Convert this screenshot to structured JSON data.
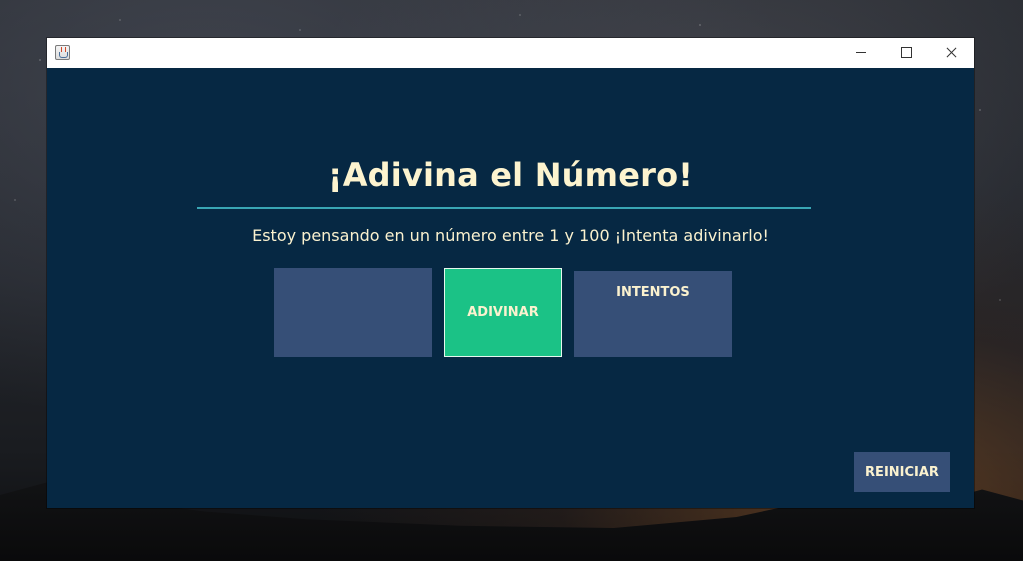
{
  "window": {
    "title": "",
    "icon": "java-coffee-cup-icon",
    "controls": {
      "minimize": "minimize-icon",
      "maximize": "maximize-icon",
      "close": "close-icon"
    }
  },
  "game": {
    "title": "¡Adivina el Número!",
    "instructions": "Estoy pensando en un número entre 1 y 100 ¡Intenta adivinarlo!",
    "guess_input_value": "",
    "guess_button_label": "ADIVINAR",
    "attempts_label": "INTENTOS",
    "restart_button_label": "REINICIAR"
  },
  "colors": {
    "window_background": "#062843",
    "title_text": "#fdf4cf",
    "underline": "#39a6b4",
    "panel": "#364f77",
    "accent_button": "#1bc286"
  }
}
